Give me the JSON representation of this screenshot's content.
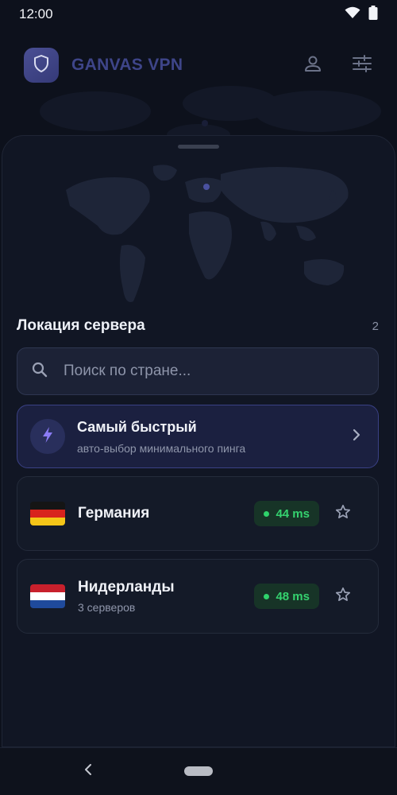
{
  "status_bar": {
    "time": "12:00"
  },
  "header": {
    "brand": "GANVAS VPN"
  },
  "servers_section": {
    "title": "Локация сервера",
    "count": "2",
    "search_placeholder": "Поиск по стране...",
    "fastest": {
      "title": "Самый быстрый",
      "subtitle": "авто-выбор минимального пинга"
    },
    "servers": [
      {
        "name": "Германия",
        "subtitle": "",
        "ping": "44 ms",
        "flag": "germany-flag"
      },
      {
        "name": "Нидерланды",
        "subtitle": "3 серверов",
        "ping": "48 ms",
        "flag": "netherlands-flag"
      }
    ]
  },
  "colors": {
    "background": "#0d111c",
    "accent": "#3a4185",
    "ping_green": "#35d26f",
    "bolt": "#8b7cf6"
  }
}
